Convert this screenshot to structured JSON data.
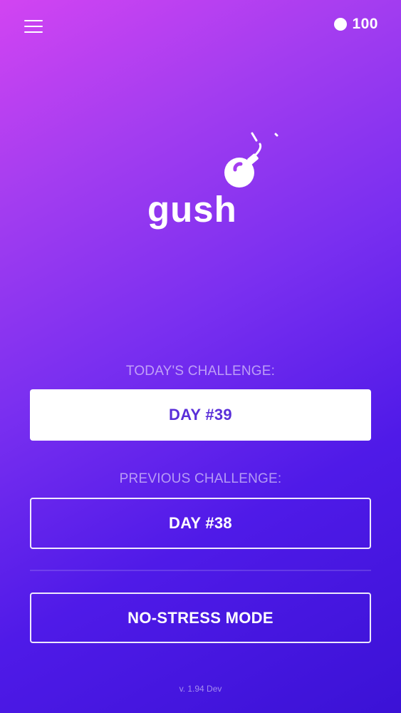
{
  "header": {
    "menu_icon": "hamburger-menu-icon",
    "coin_icon": "coin-icon",
    "coin_count": "100"
  },
  "logo": {
    "text": "gush",
    "icon": "bomb-icon"
  },
  "today": {
    "label": "TODAY'S CHALLENGE:",
    "button": "DAY #39"
  },
  "previous": {
    "label": "PREVIOUS CHALLENGE:",
    "button": "DAY #38"
  },
  "modes": {
    "no_stress": "NO-STRESS MODE"
  },
  "footer": {
    "version": "v. 1.94 Dev"
  },
  "colors": {
    "gradient_start": "#d244f2",
    "gradient_end": "#3b12d6",
    "accent": "#5a2fd9",
    "text": "#ffffff"
  }
}
